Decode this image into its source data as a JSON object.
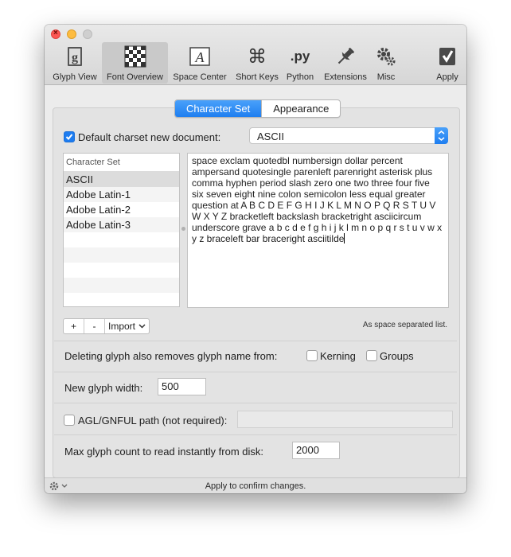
{
  "toolbar": {
    "items": [
      {
        "label": "Glyph View",
        "icon": "glyph-view-icon"
      },
      {
        "label": "Font Overview",
        "icon": "font-overview-icon"
      },
      {
        "label": "Space Center",
        "icon": "space-center-icon"
      },
      {
        "label": "Short Keys",
        "icon": "command-key-icon"
      },
      {
        "label": "Python",
        "icon": "python-icon"
      },
      {
        "label": "Extensions",
        "icon": "pin-icon"
      },
      {
        "label": "Misc",
        "icon": "gears-icon"
      },
      {
        "label": "Apply",
        "icon": "apply-check-icon"
      }
    ],
    "icon_text": {
      "glyph": "g",
      "space": "A",
      "cmd": "⌘",
      "py": ".py"
    }
  },
  "tabs": {
    "character_set": "Character Set",
    "appearance": "Appearance"
  },
  "charset": {
    "default_label": "Default charset new document:",
    "default_checked": true,
    "selected": "ASCII",
    "list_header": "Character Set",
    "list": [
      "ASCII",
      "Adobe Latin-1",
      "Adobe Latin-2",
      "Adobe Latin-3"
    ],
    "lines": [
      "space exclam quotedbl numbersign dollar percent",
      "ampersand quotesingle parenleft parenright asterisk plus",
      "comma hyphen period slash zero one two three four five",
      "six seven eight nine colon semicolon less equal greater",
      "question at A B C D E F G H I J K L M N O P Q R S T U V",
      "W X Y Z bracketleft backslash bracketright asciicircum",
      "underscore grave a b c d e f g h i j k l m n o p q r s t u v w x",
      "y z braceleft bar braceright asciitilde"
    ],
    "add_button": "+",
    "remove_button": "-",
    "import_label": "Import",
    "hint": "As space separated list."
  },
  "settings": {
    "deleting_label": "Deleting glyph also removes glyph name from:",
    "kerning_label": "Kerning",
    "groups_label": "Groups",
    "new_width_label": "New glyph width:",
    "new_width_value": "500",
    "agl_label": "AGL/GNFUL path (not required):",
    "agl_value": "",
    "max_glyph_label": "Max glyph count to read instantly from disk:",
    "max_glyph_value": "2000"
  },
  "status": "Apply to confirm changes.",
  "colors": {
    "accent": "#1e7ef0",
    "close": "#fc5753",
    "minimize": "#fdbc40"
  }
}
